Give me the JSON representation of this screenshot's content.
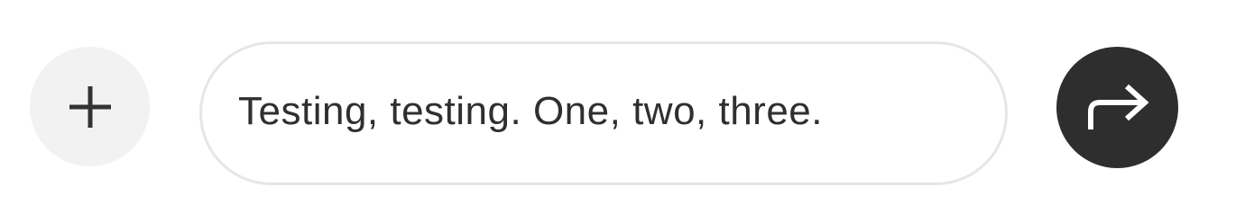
{
  "composer": {
    "add_icon": "plus-icon",
    "message_value": "Testing, testing. One, two, three.",
    "send_icon": "forward-arrow-icon"
  },
  "colors": {
    "add_button_bg": "#f2f2f2",
    "field_border": "#e6e6e6",
    "send_button_bg": "#2e2e2e",
    "text": "#2f2f2f"
  }
}
